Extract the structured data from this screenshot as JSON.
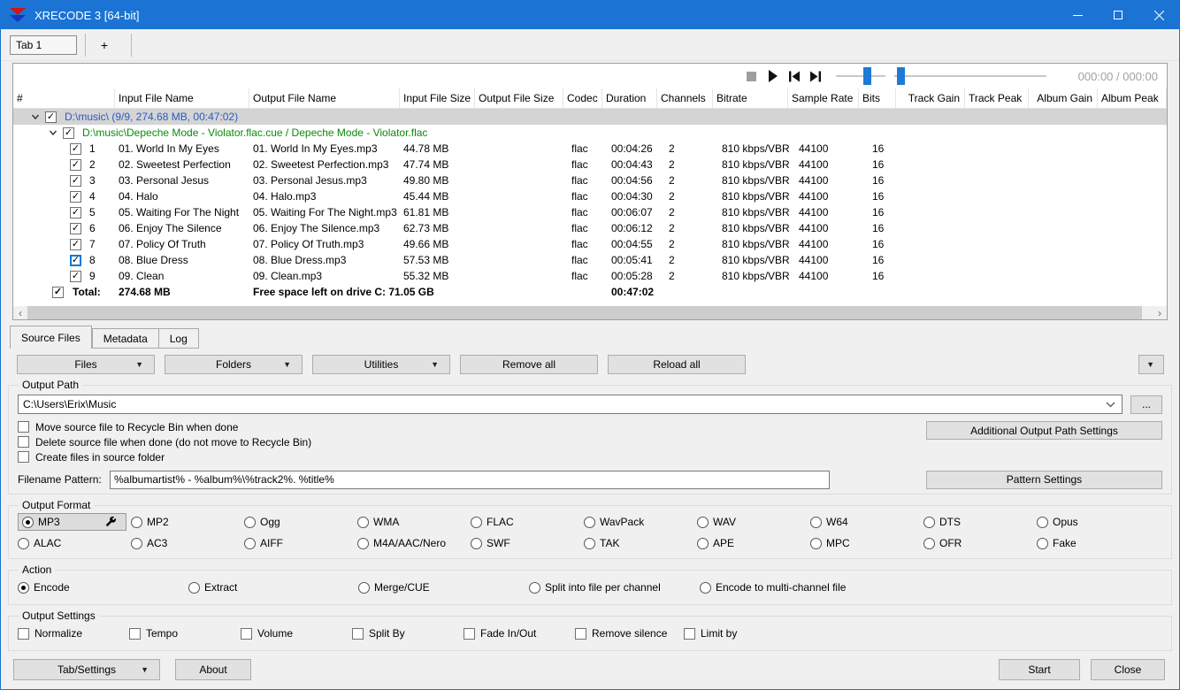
{
  "window": {
    "title": "XRECODE 3 [64-bit]"
  },
  "tabs_top": {
    "tab1": "Tab 1",
    "add": "+"
  },
  "player": {
    "time": "000:00 / 000:00",
    "volume_percent": 65,
    "position_percent": 2
  },
  "table": {
    "columns": [
      "#",
      "Input File Name",
      "Output File Name",
      "Input File Size",
      "Output File Size",
      "Codec",
      "Duration",
      "Channels",
      "Bitrate",
      "Sample Rate",
      "Bits",
      "Track Gain",
      "Track Peak",
      "Album Gain",
      "Album Peak"
    ],
    "root_row": {
      "label": "D:\\music\\ (9/9, 274.68 MB, 00:47:02)",
      "checked": true
    },
    "cue_row": {
      "label": "D:\\music\\Depeche Mode - Violator.flac.cue / Depeche Mode - Violator.flac",
      "checked": true
    },
    "tracks": [
      {
        "num": "1",
        "input": "01. World In My Eyes",
        "output": "01. World In My Eyes.mp3",
        "size": "44.78 MB",
        "codec": "flac",
        "duration": "00:04:26",
        "channels": "2",
        "bitrate": "810 kbps/VBR",
        "sample_rate": "44100",
        "bits": "16",
        "checked": true,
        "focused": false
      },
      {
        "num": "2",
        "input": "02. Sweetest Perfection",
        "output": "02. Sweetest Perfection.mp3",
        "size": "47.74 MB",
        "codec": "flac",
        "duration": "00:04:43",
        "channels": "2",
        "bitrate": "810 kbps/VBR",
        "sample_rate": "44100",
        "bits": "16",
        "checked": true,
        "focused": false
      },
      {
        "num": "3",
        "input": "03. Personal Jesus",
        "output": "03. Personal Jesus.mp3",
        "size": "49.80 MB",
        "codec": "flac",
        "duration": "00:04:56",
        "channels": "2",
        "bitrate": "810 kbps/VBR",
        "sample_rate": "44100",
        "bits": "16",
        "checked": true,
        "focused": false
      },
      {
        "num": "4",
        "input": "04. Halo",
        "output": "04. Halo.mp3",
        "size": "45.44 MB",
        "codec": "flac",
        "duration": "00:04:30",
        "channels": "2",
        "bitrate": "810 kbps/VBR",
        "sample_rate": "44100",
        "bits": "16",
        "checked": true,
        "focused": false
      },
      {
        "num": "5",
        "input": "05. Waiting For The Night",
        "output": "05. Waiting For The Night.mp3",
        "size": "61.81 MB",
        "codec": "flac",
        "duration": "00:06:07",
        "channels": "2",
        "bitrate": "810 kbps/VBR",
        "sample_rate": "44100",
        "bits": "16",
        "checked": true,
        "focused": false
      },
      {
        "num": "6",
        "input": "06. Enjoy The Silence",
        "output": "06. Enjoy The Silence.mp3",
        "size": "62.73 MB",
        "codec": "flac",
        "duration": "00:06:12",
        "channels": "2",
        "bitrate": "810 kbps/VBR",
        "sample_rate": "44100",
        "bits": "16",
        "checked": true,
        "focused": false
      },
      {
        "num": "7",
        "input": "07. Policy Of Truth",
        "output": "07. Policy Of Truth.mp3",
        "size": "49.66 MB",
        "codec": "flac",
        "duration": "00:04:55",
        "channels": "2",
        "bitrate": "810 kbps/VBR",
        "sample_rate": "44100",
        "bits": "16",
        "checked": true,
        "focused": false
      },
      {
        "num": "8",
        "input": "08. Blue Dress",
        "output": "08. Blue Dress.mp3",
        "size": "57.53 MB",
        "codec": "flac",
        "duration": "00:05:41",
        "channels": "2",
        "bitrate": "810 kbps/VBR",
        "sample_rate": "44100",
        "bits": "16",
        "checked": true,
        "focused": true
      },
      {
        "num": "9",
        "input": "09. Clean",
        "output": "09. Clean.mp3",
        "size": "55.32 MB",
        "codec": "flac",
        "duration": "00:05:28",
        "channels": "2",
        "bitrate": "810 kbps/VBR",
        "sample_rate": "44100",
        "bits": "16",
        "checked": true,
        "focused": false
      }
    ],
    "total": {
      "label": "Total:",
      "size": "274.68 MB",
      "free": "Free space left on drive C: 71.05 GB",
      "duration": "00:47:02",
      "checked": true
    }
  },
  "page_tabs": [
    "Source Files",
    "Metadata",
    "Log"
  ],
  "toolbar": {
    "files": "Files",
    "folders": "Folders",
    "utilities": "Utilities",
    "remove_all": "Remove all",
    "reload_all": "Reload all"
  },
  "output_path": {
    "label": "Output Path",
    "value": "C:\\Users\\Erix\\Music",
    "browse": "...",
    "checkboxes": [
      "Move source file to Recycle Bin when done",
      "Delete source file when done (do not move to Recycle Bin)",
      "Create files in source folder"
    ],
    "additional": "Additional Output Path Settings",
    "pattern_label": "Filename Pattern:",
    "pattern_value": "%albumartist% - %album%\\%track2%. %title%",
    "pattern_settings": "Pattern Settings"
  },
  "output_format": {
    "label": "Output Format",
    "selected": "MP3",
    "row1": [
      "MP3",
      "MP2",
      "Ogg",
      "WMA",
      "FLAC",
      "WavPack",
      "WAV",
      "W64",
      "DTS",
      "Opus"
    ],
    "row2": [
      "ALAC",
      "AC3",
      "AIFF",
      "M4A/AAC/Nero",
      "SWF",
      "TAK",
      "APE",
      "MPC",
      "OFR",
      "Fake"
    ]
  },
  "action": {
    "label": "Action",
    "selected": "Encode",
    "options": [
      "Encode",
      "Extract",
      "Merge/CUE",
      "Split into file per channel",
      "Encode to multi-channel file"
    ]
  },
  "output_settings": {
    "label": "Output Settings",
    "options": [
      "Normalize",
      "Tempo",
      "Volume",
      "Split By",
      "Fade In/Out",
      "Remove silence",
      "Limit by"
    ]
  },
  "footer": {
    "tab_settings": "Tab/Settings",
    "about": "About",
    "start": "Start",
    "close": "Close"
  },
  "colors": {
    "titlebar": "#1b73d4",
    "slider_accent": "#1f7ad6",
    "selected_row_bg": "#d4d4d4",
    "root_text": "#2a5ac6",
    "cue_text": "#0a8a0a"
  }
}
